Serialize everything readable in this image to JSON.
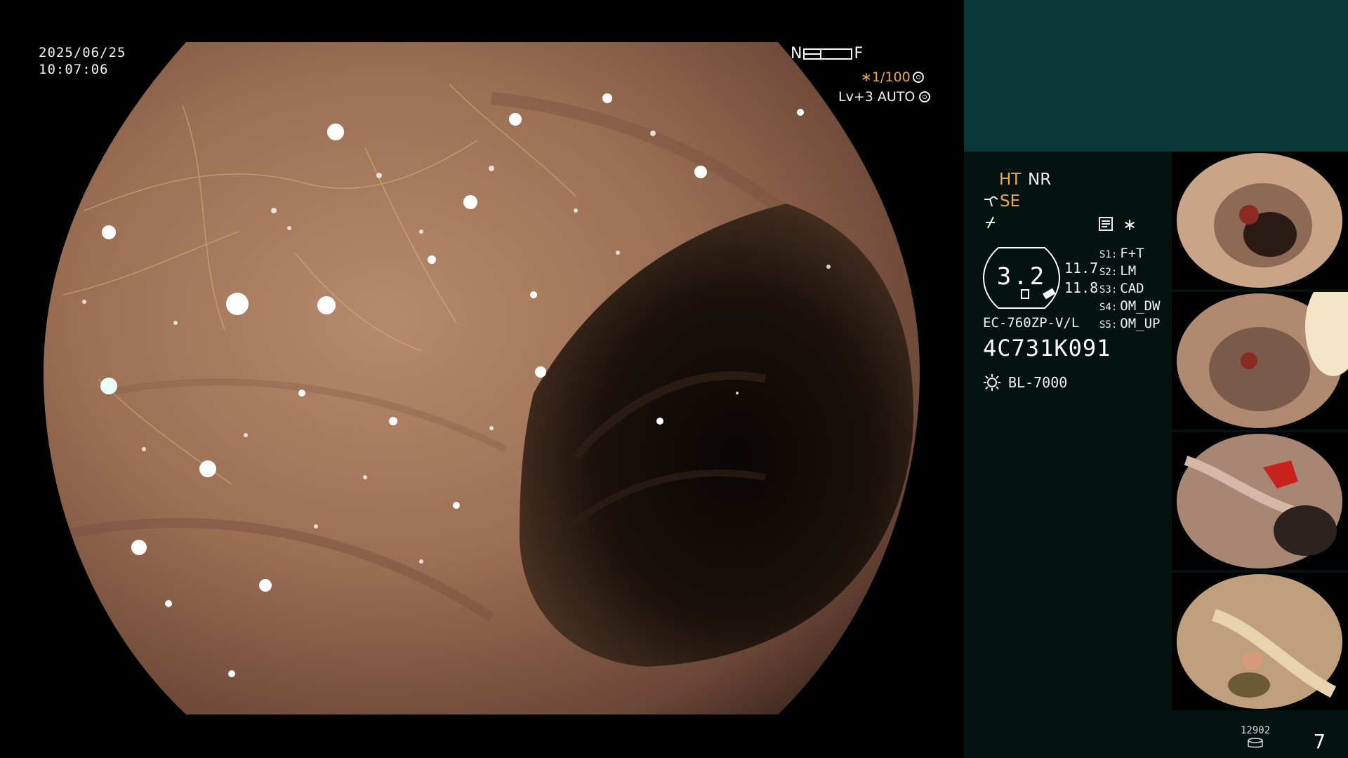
{
  "overlay": {
    "date": "2025/06/25",
    "time": "10:07:06",
    "near_label": "N",
    "far_label": "F",
    "shutter": "∗1/100",
    "level": "Lv+3",
    "exposure": "AUTO"
  },
  "panel": {
    "mode_ht": "HT",
    "mode_nr": "NR",
    "mode_se": "SE",
    "badge_value": "3.2",
    "readout_1": "11.7",
    "readout_2": "11.8",
    "scope_model": "EC-760ZP-V/L",
    "scope_serial": "4C731K091",
    "light_source": "BL-7000",
    "star": "∗",
    "switches": [
      {
        "key": "S1:",
        "value": "F+T"
      },
      {
        "key": "S2:",
        "value": "LM"
      },
      {
        "key": "S3:",
        "value": "CAD"
      },
      {
        "key": "S4:",
        "value": "OM_DW"
      },
      {
        "key": "S5:",
        "value": "OM_UP"
      }
    ],
    "counter": "12902",
    "page": "7"
  },
  "icons": {
    "shutter_icon": "aperture-icon",
    "auto_icon": "auto-exposure-icon",
    "scope_angle_icon": "scope-tip-icon",
    "zoom_icon": "zoom-lever-icon",
    "memo_icon": "memo-icon",
    "light_icon": "lamp-icon",
    "storage_icon": "storage-disk-icon"
  },
  "colors": {
    "panel_bg": "#041210",
    "panel_header": "#0a3a38",
    "accent_orange": "#f0a93a"
  }
}
